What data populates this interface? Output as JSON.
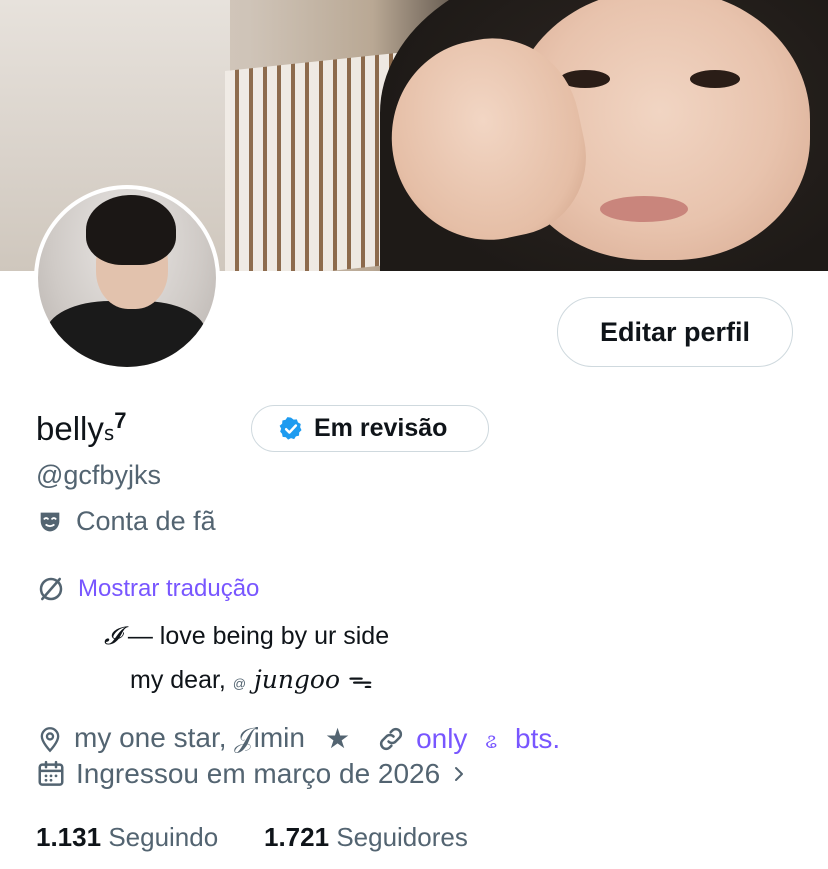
{
  "profile": {
    "display_name": "belly",
    "name_suffix": "ꜱ",
    "name_superscript": "7",
    "review_badge": "Em revisão",
    "handle": "@gcfbyjks",
    "category": "Conta de fã",
    "translate_link": "Mostrar tradução",
    "bio_line1_script": "𝓘",
    "bio_line1_text": " — love being by ur side",
    "bio_line2_text": "my dear, ",
    "bio_line2_tiny": "@",
    "bio_line2_script": " jungoo ",
    "bio_line2_symbol": "ᯓ",
    "location": "my  one  star, 𝒥imin",
    "location_star": "★",
    "link_text": "only",
    "link_symbol": "ଌ",
    "link_suffix": "bts.",
    "joined": "Ingressou em março de 2026",
    "following_count": "1.131",
    "following_label": "Seguindo",
    "followers_count": "1.721",
    "followers_label": "Seguidores"
  },
  "actions": {
    "edit_profile": "Editar perfil"
  },
  "colors": {
    "text_primary": "#0f1419",
    "text_secondary": "#536471",
    "link": "#7856ff",
    "badge_blue": "#1d9bf0",
    "border": "#cfd9de"
  },
  "icons": [
    "verified-badge-icon",
    "mask-icon",
    "translate-icon",
    "location-pin-icon",
    "link-icon",
    "calendar-icon",
    "chevron-right-icon"
  ]
}
